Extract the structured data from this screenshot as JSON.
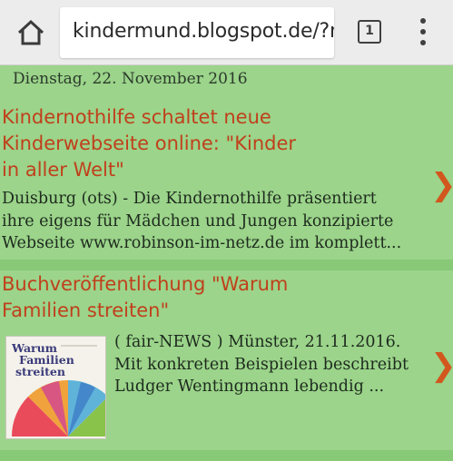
{
  "browser": {
    "url": "kindermund.blogspot.de/?m",
    "tab_count": "1",
    "icons": {
      "home": "home-icon",
      "tabs": "tab-switcher-icon",
      "menu": "overflow-menu-icon"
    }
  },
  "blog": {
    "date": "Dienstag, 22. November 2016",
    "posts": [
      {
        "title_lines": [
          "Kindernothilfe schaltet neue",
          "Kinderwebseite online: \"Kinder",
          "in aller Welt\""
        ],
        "snippet_lines": [
          "Duisburg (ots) - Die Kindernothilfe präsentiert",
          "ihre eigens für Mädchen und Jungen konzipierte",
          "Webseite www.robinson-im-netz.de im komplett..."
        ],
        "chevron": "❯"
      },
      {
        "title_lines": [
          "Buchveröffentlichung \"Warum",
          "Familien streiten\""
        ],
        "snippet_lines": [
          "( fair-NEWS ) Münster, 21.11.2016.",
          "Mit konkreten Beispielen beschreibt",
          "Ludger Wentingmann lebendig ..."
        ],
        "thumbnail_title_lines": [
          "Warum",
          "Familien",
          "streiten"
        ],
        "chevron": "❯"
      }
    ]
  },
  "colors": {
    "background": "#9bd48a",
    "divider": "#87c976",
    "title": "#c0401c",
    "chevron": "#d2571e"
  }
}
